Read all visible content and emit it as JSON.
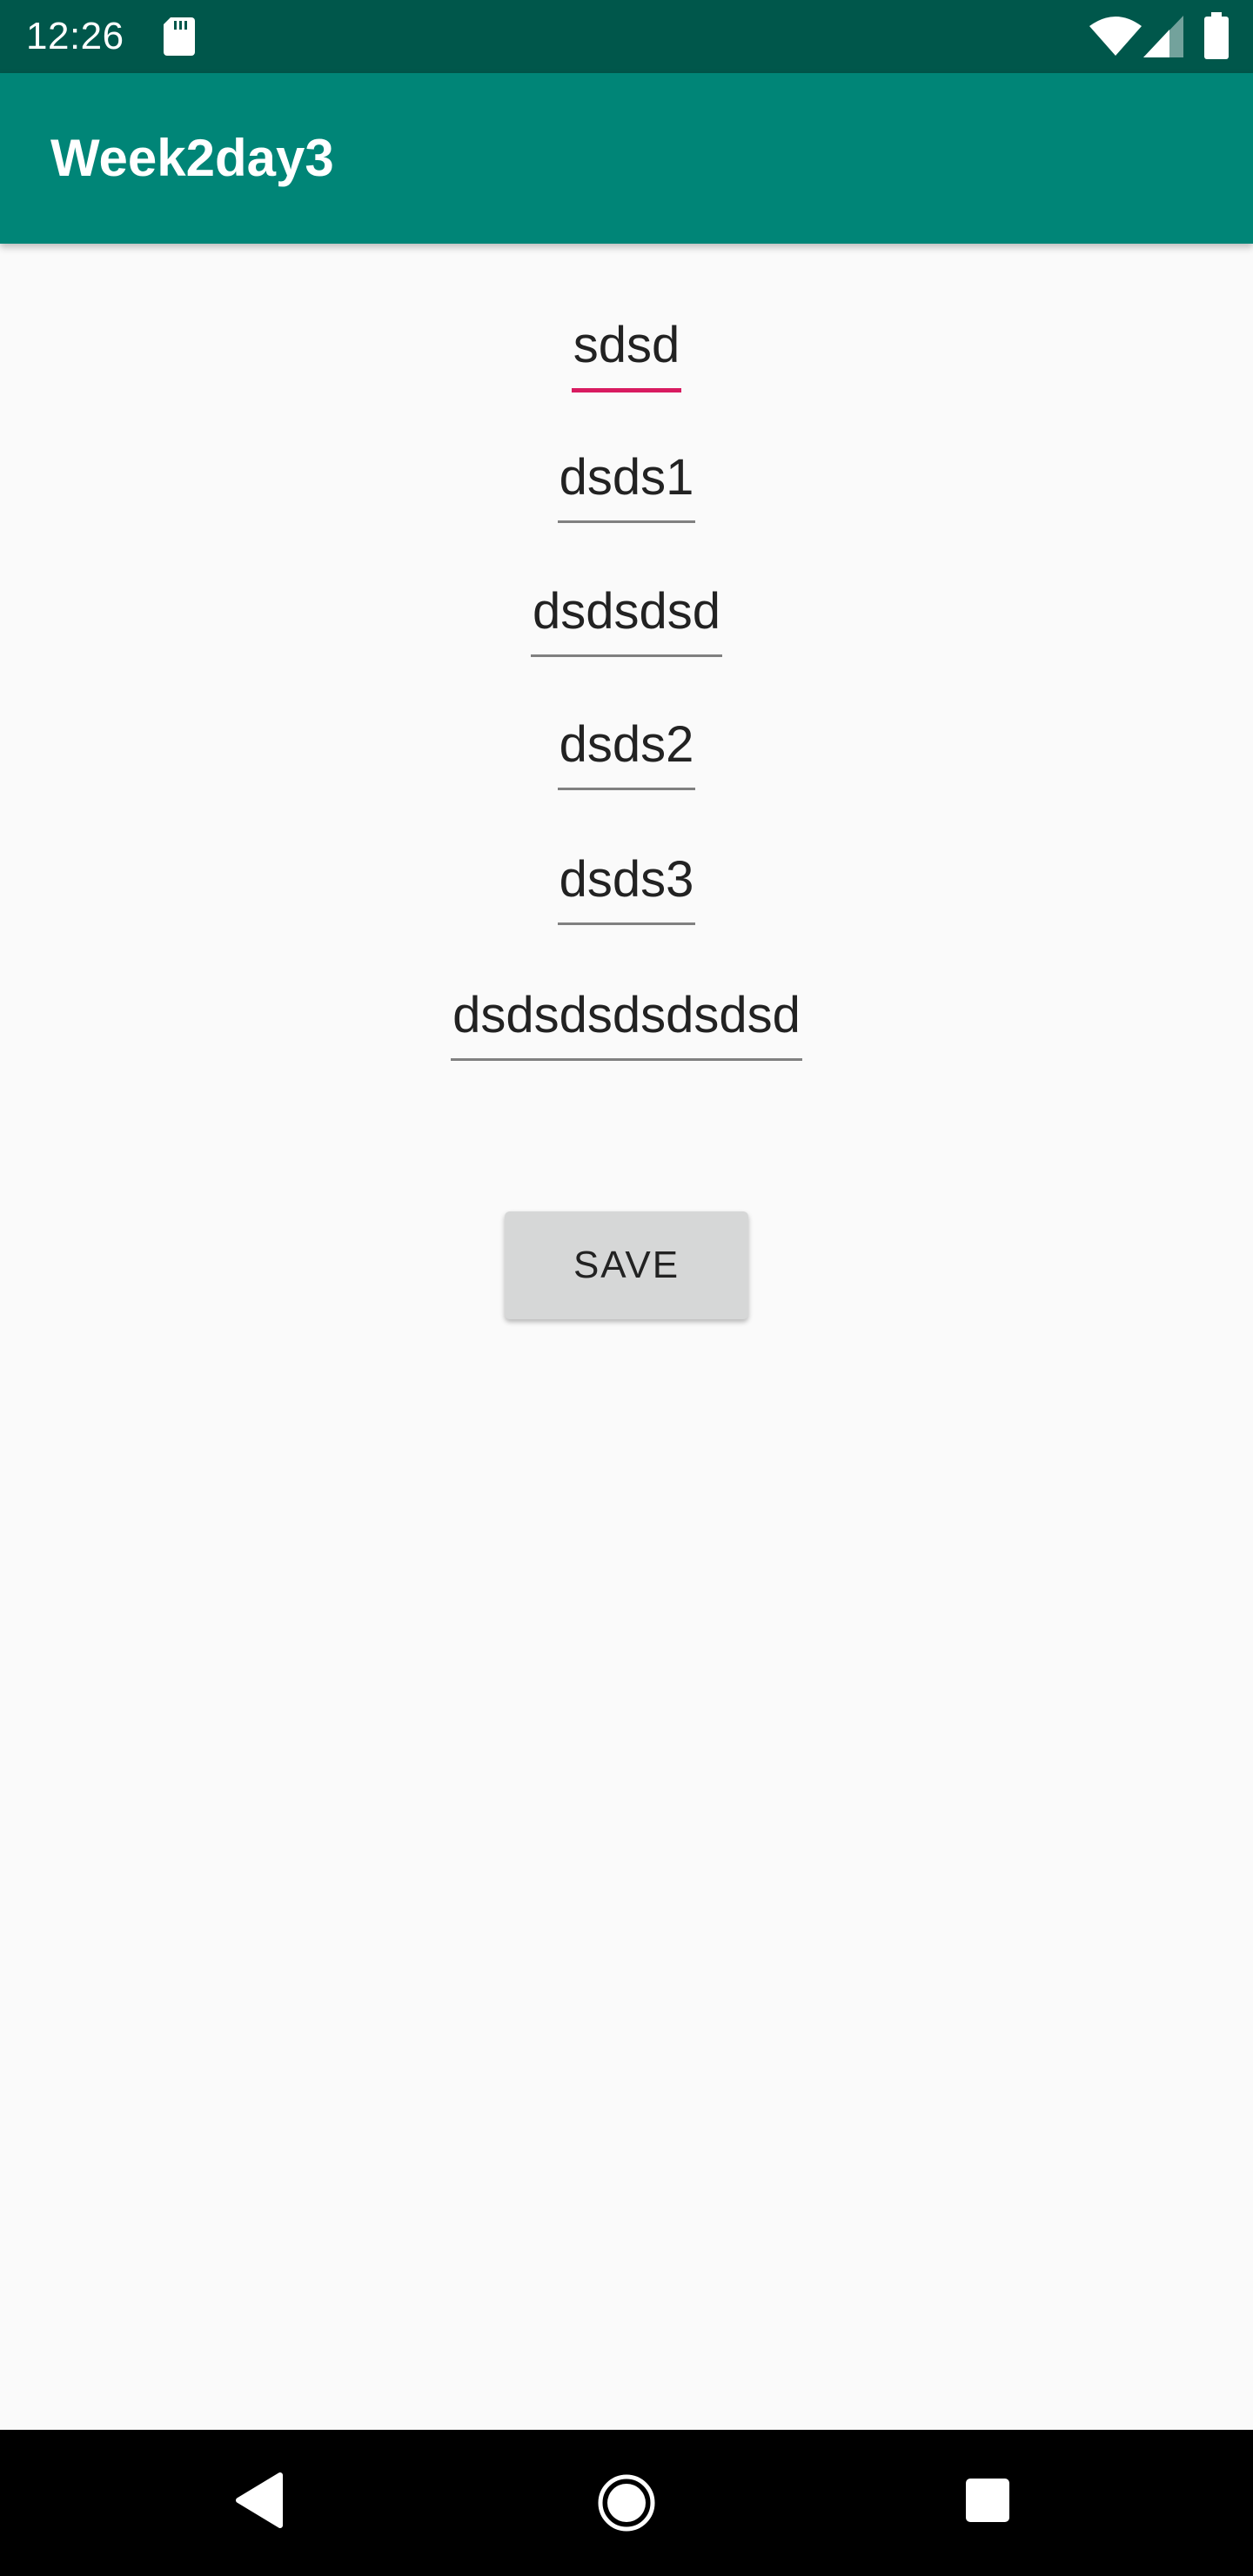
{
  "status_bar": {
    "time": "12:26",
    "icons": [
      "sd-card-icon",
      "wifi-icon",
      "cell-signal-icon",
      "battery-icon"
    ]
  },
  "app_bar": {
    "title": "Week2day3",
    "color": "#008577"
  },
  "form": {
    "fields": [
      {
        "value": "sdsd",
        "focused": true
      },
      {
        "value": "dsds1",
        "focused": false
      },
      {
        "value": "dsdsdsd",
        "focused": false
      },
      {
        "value": "dsds2",
        "focused": false
      },
      {
        "value": "dsds3",
        "focused": false
      },
      {
        "value": "dsdsdsdsdsdsd",
        "focused": false
      }
    ],
    "save_label": "SAVE",
    "accent_color": "#d81b60"
  },
  "nav_bar": {
    "icons": [
      "back-icon",
      "home-icon",
      "recents-icon"
    ]
  }
}
